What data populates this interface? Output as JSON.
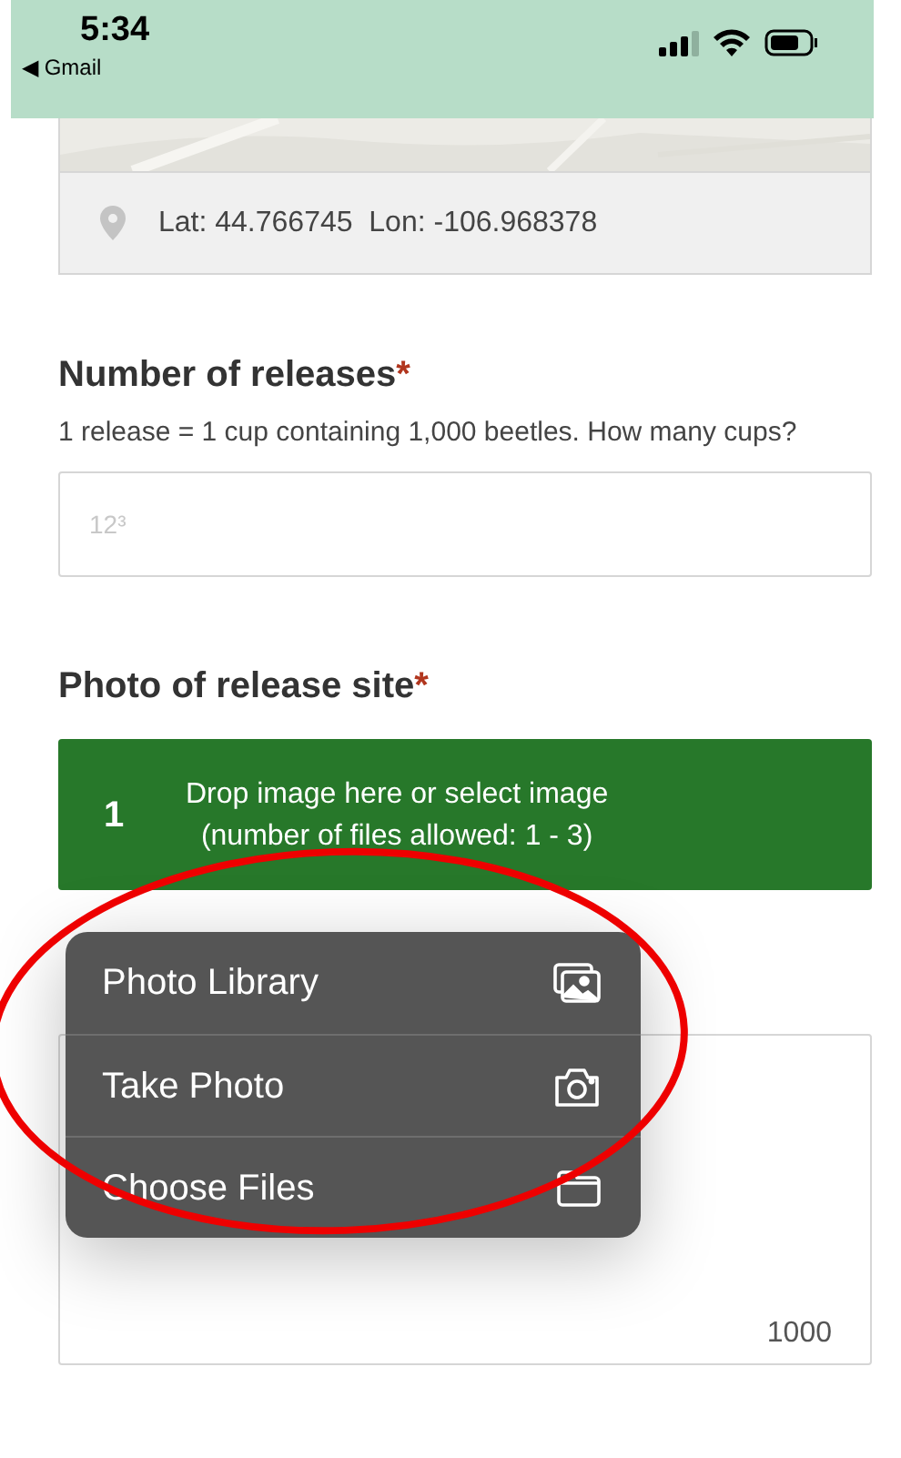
{
  "status_bar": {
    "time": "5:34",
    "back_label": "◀ Gmail"
  },
  "location": {
    "text": "Lat: 44.766745  Lon: -106.968378"
  },
  "releases": {
    "label": "Number of releases",
    "required_mark": "*",
    "hint": "1 release = 1 cup containing 1,000 beetles. How many cups?",
    "placeholder": "12³"
  },
  "photo": {
    "label": "Photo of release site",
    "required_mark": "*",
    "count": "1",
    "drop_text": "Drop image here or select image",
    "limit_text": "(number of files allowed: 1 - 3)"
  },
  "notes": {
    "counter": "1000"
  },
  "menu": {
    "items": [
      {
        "label": "Photo Library",
        "kind": "library"
      },
      {
        "label": "Take Photo",
        "kind": "camera"
      },
      {
        "label": "Choose Files",
        "kind": "folder"
      }
    ]
  }
}
